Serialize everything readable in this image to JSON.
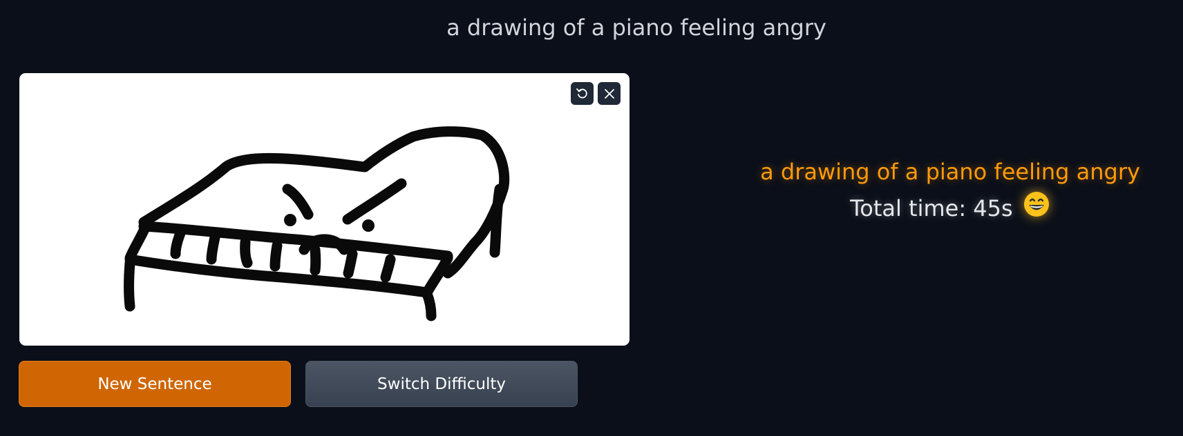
{
  "prompt": "a drawing of a piano feeling angry",
  "canvas": {
    "undo_icon": "undo-icon",
    "clear_icon": "close-icon"
  },
  "buttons": {
    "new_sentence": "New Sentence",
    "switch_difficulty": "Switch Difficulty"
  },
  "result": {
    "prompt": "a drawing of a piano feeling angry",
    "time_text": "Total time: 45s",
    "emoji": "grinning-face-emoji"
  },
  "colors": {
    "background": "#0b0f19",
    "accent": "#ff9a0a",
    "primary_button": "#cf6603"
  }
}
